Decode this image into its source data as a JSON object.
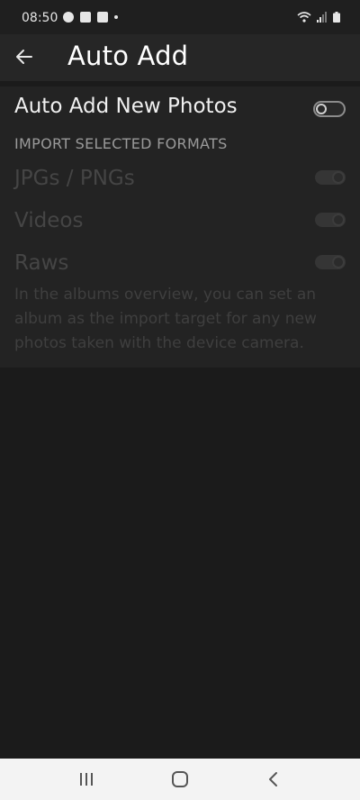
{
  "status_bar": {
    "time": "08:50",
    "left_icons": [
      "chrome-icon",
      "gallery-icon",
      "notification-badge-icon",
      "dot-icon"
    ],
    "right_icons": [
      "wifi-icon",
      "signal-icon",
      "battery-icon"
    ]
  },
  "app_bar": {
    "title": "Auto Add",
    "back_icon": "arrow-left-icon"
  },
  "settings": {
    "auto_add_label": "Auto Add New Photos",
    "auto_add_enabled": false,
    "section_header": "IMPORT SELECTED FORMATS",
    "formats": [
      {
        "label": "JPGs / PNGs",
        "enabled": true,
        "disabled": true
      },
      {
        "label": "Videos",
        "enabled": true,
        "disabled": true
      },
      {
        "label": "Raws",
        "enabled": true,
        "disabled": true
      }
    ],
    "helper_text": "In the albums overview, you can set an album as the import target for any new photos taken with the device camera."
  },
  "nav_bar": {
    "buttons": [
      "recent-apps-icon",
      "home-icon",
      "back-icon"
    ]
  },
  "colors": {
    "background": "#1b1b1b",
    "panel": "#232323",
    "app_bar": "#262626",
    "nav_bar": "#f3f3f3"
  }
}
